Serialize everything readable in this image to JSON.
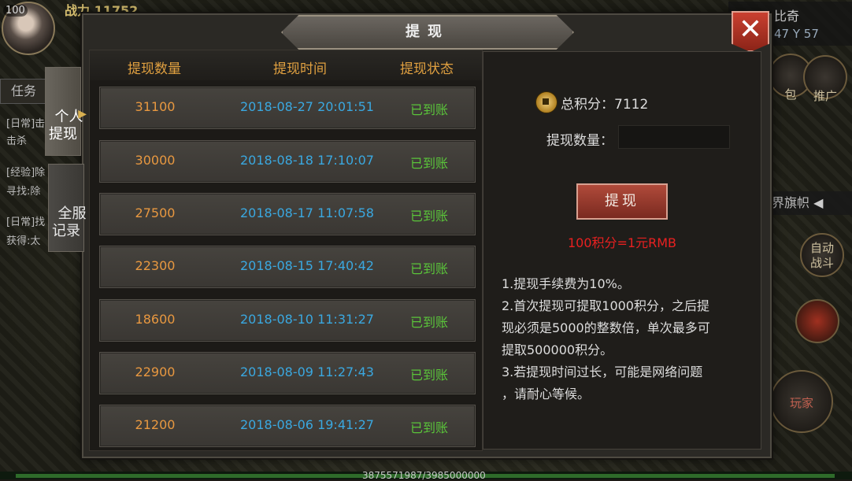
{
  "hud": {
    "level": "100",
    "power": "战力 11752",
    "task_tab": "任务",
    "logs": [
      "[日常]击",
      "击杀",
      "[经验]除",
      "寻找:除",
      "[日常]找",
      "获得:太"
    ],
    "player_name": "比奇",
    "coords": "47 Y 57",
    "btn_promo": "推广",
    "btn_bag": "包",
    "flag_label": "界旗帜",
    "auto_battle": "自动\n战斗",
    "play_label": "玩家",
    "exp_text": "3875571987/3985000000"
  },
  "dialog": {
    "title": "提现",
    "close_label": "✕",
    "tabs": [
      {
        "label": "个人\n提现",
        "active": true
      },
      {
        "label": "全服\n记录",
        "active": false
      }
    ],
    "list": {
      "headers": {
        "amount": "提现数量",
        "time": "提现时间",
        "status": "提现状态"
      },
      "rows": [
        {
          "amount": "31100",
          "time": "2018-08-27 20:01:51",
          "status": "已到账"
        },
        {
          "amount": "30000",
          "time": "2018-08-18 17:10:07",
          "status": "已到账"
        },
        {
          "amount": "27500",
          "time": "2018-08-17 11:07:58",
          "status": "已到账"
        },
        {
          "amount": "22300",
          "time": "2018-08-15 17:40:42",
          "status": "已到账"
        },
        {
          "amount": "18600",
          "time": "2018-08-10 11:31:27",
          "status": "已到账"
        },
        {
          "amount": "22900",
          "time": "2018-08-09 11:27:43",
          "status": "已到账"
        },
        {
          "amount": "21200",
          "time": "2018-08-06 19:41:27",
          "status": "已到账"
        }
      ]
    },
    "form": {
      "total_points": "总积分：7112",
      "amount_label": "提现数量：",
      "amount_value": "",
      "withdraw_button": "提现",
      "rate": "100积分=1元RMB",
      "notes": [
        "1.提现手续费为10%。",
        "2.首次提现可提取1000积分，之后提",
        "现必须是5000的整数倍，单次最多可",
        "提取500000积分。",
        "3.若提现时间过长，可能是网络问题",
        "，请耐心等候。"
      ]
    }
  }
}
